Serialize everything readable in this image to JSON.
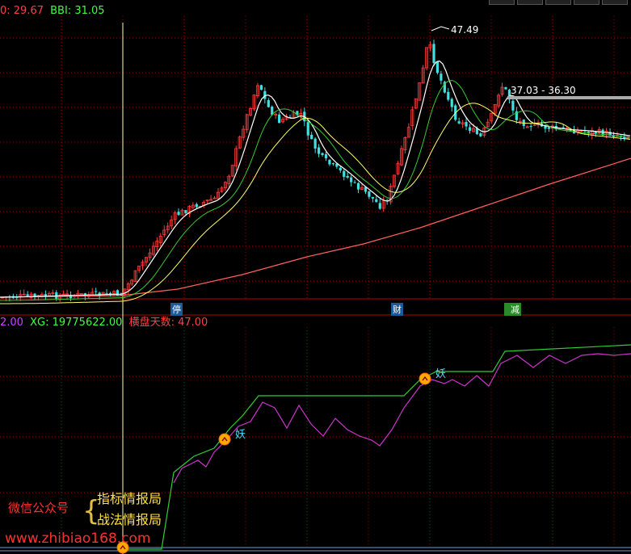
{
  "top_legend": {
    "ma_label": "0: 29.67",
    "bbi_label": "BBI: 31.05"
  },
  "bottom_legend": {
    "value_label": "2.00",
    "xg_label": "XG: 19775622.00",
    "flat_label": "横盘天数: 47.00"
  },
  "markers": {
    "stop": "停",
    "cai": "财",
    "jian": "减"
  },
  "annotations": {
    "high": "47.49",
    "range": "37.03 - 36.30",
    "yao": "妖"
  },
  "promo": {
    "wechat": "微信公众号",
    "line1": "指标情报局",
    "line2": "战法情报局",
    "website": "www.zhibiao168.com"
  },
  "colors": {
    "up": "#ff3b3b",
    "down": "#40e0e0",
    "ma5": "#ffffff",
    "ma10": "#ffff66",
    "ma20": "#33cc33",
    "ma60": "#ff6060",
    "grid": "#9b0000",
    "xg": "#33cc33",
    "flat": "#cc33cc",
    "cursor": "#ffffa0"
  },
  "chart_data": [
    {
      "type": "candlestick",
      "panel": "price",
      "n_bars": 175,
      "series": [
        {
          "name": "BBI",
          "values_note": "moving-average lines"
        }
      ],
      "annotations": [
        "47.49",
        "37.03 - 36.30"
      ],
      "max_price": 47.49
    },
    {
      "type": "line",
      "panel": "indicator",
      "series": [
        {
          "name": "XG",
          "last": 19775622.0
        },
        {
          "name": "横盘天数",
          "last": 47.0
        }
      ]
    }
  ]
}
